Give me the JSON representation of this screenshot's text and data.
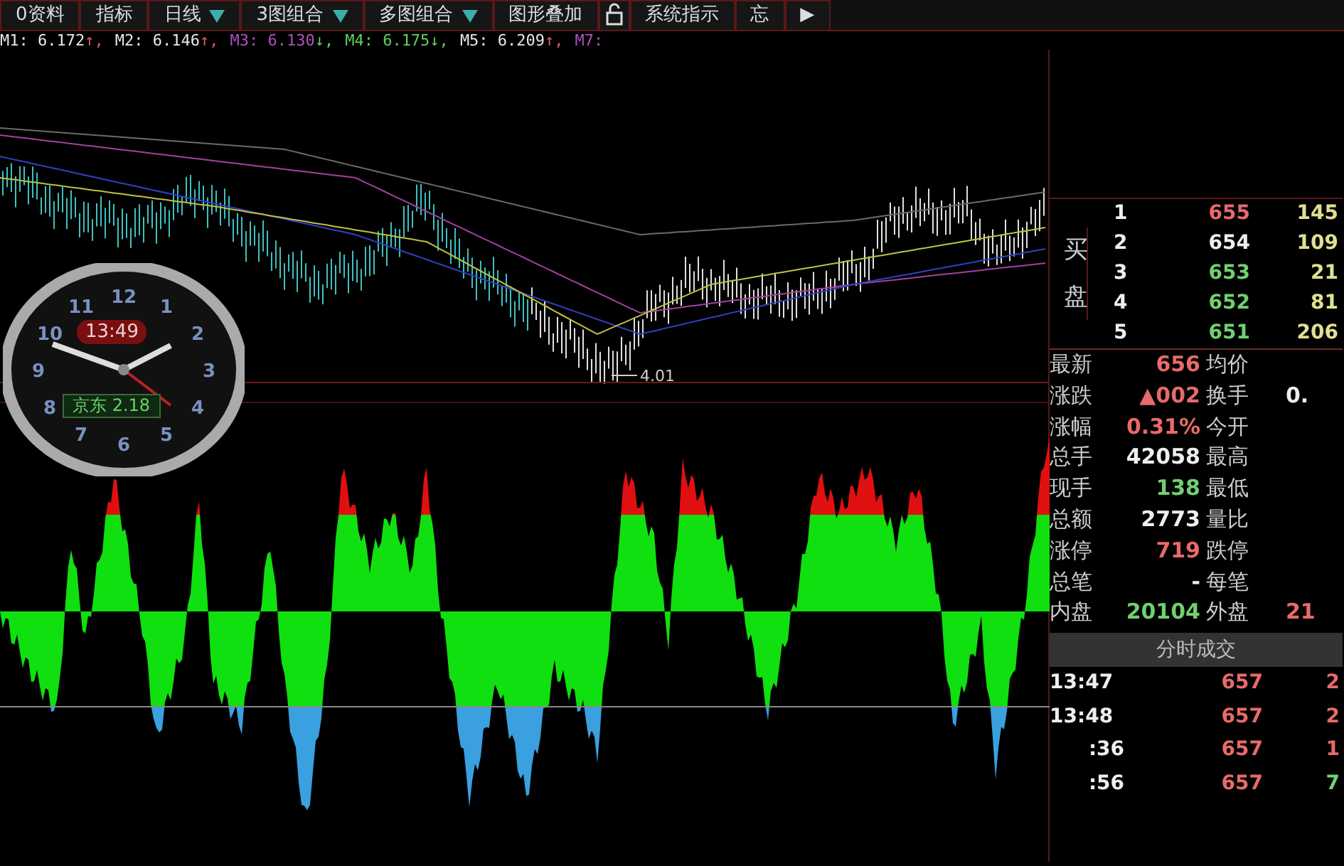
{
  "toolbar": [
    {
      "kind": "button",
      "label": "0资料"
    },
    {
      "kind": "button",
      "label": "指标"
    },
    {
      "kind": "dropdown",
      "label": "日线"
    },
    {
      "kind": "dropdown",
      "label": "3图组合"
    },
    {
      "kind": "dropdown",
      "label": "多图组合"
    },
    {
      "kind": "button",
      "label": "图形叠加"
    },
    {
      "kind": "lock"
    },
    {
      "kind": "button",
      "label": "系统指示"
    },
    {
      "kind": "button",
      "label": "忘"
    },
    {
      "kind": "button",
      "label": "▶"
    }
  ],
  "ma_line": [
    {
      "label": "M1:",
      "value": "6.172",
      "color": "#e8e8e8",
      "arrow": {
        "text": "↑,",
        "color": "#e06060"
      }
    },
    {
      "label": "M2:",
      "value": "6.146",
      "color": "#e8e8e8",
      "arrow": {
        "text": "↑,",
        "color": "#e06060"
      }
    },
    {
      "label": "M3:",
      "value": "6.130",
      "color": "#b050c0",
      "arrow": {
        "text": "↓,",
        "color": "#60d060"
      }
    },
    {
      "label": "M4:",
      "value": "6.175",
      "color": "#60d060",
      "arrow": {
        "text": "↓,",
        "color": "#60d060"
      }
    },
    {
      "label": "M5:",
      "value": "6.209",
      "color": "#e8e8e8",
      "arrow": {
        "text": "↑,",
        "color": "#e06060"
      }
    },
    {
      "label": "M7:",
      "color": "#b050c0"
    }
  ],
  "price_chart": {
    "low_label": "4.01"
  },
  "clock": {
    "numbers": [
      "12",
      "1",
      "2",
      "3",
      "4",
      "5",
      "6",
      "7",
      "8",
      "9",
      "10",
      "11"
    ],
    "time": "13:49",
    "ticker": "京东 2.18"
  },
  "order_book": {
    "side_label": "买盘",
    "levels": [
      {
        "level": "1",
        "price": "655",
        "volume": "145",
        "color": "#e86a6a"
      },
      {
        "level": "2",
        "price": "654",
        "volume": "109",
        "color": "#eeeeee"
      },
      {
        "level": "3",
        "price": "653",
        "volume": "21",
        "color": "#70d070"
      },
      {
        "level": "4",
        "price": "652",
        "volume": "81",
        "color": "#70d070"
      },
      {
        "level": "5",
        "price": "651",
        "volume": "206",
        "color": "#70d070"
      }
    ]
  },
  "stats": [
    {
      "left": {
        "label": "最新",
        "value": "656",
        "color": "#e86a6a"
      },
      "right": {
        "label": "均价"
      }
    },
    {
      "left": {
        "label": "涨跌",
        "value": "▲002",
        "color": "#e86a6a"
      },
      "right": {
        "label": "换手",
        "value": "0.",
        "color": "#eeeeee"
      }
    },
    {
      "left": {
        "label": "涨幅",
        "value": "0.31%",
        "color": "#e86a6a"
      },
      "right": {
        "label": "今开"
      }
    },
    {
      "left": {
        "label": "总手",
        "value": "42058",
        "color": "#eeeeee"
      },
      "right": {
        "label": "最高"
      }
    },
    {
      "left": {
        "label": "现手",
        "value": "138",
        "color": "#70d070"
      },
      "right": {
        "label": "最低"
      }
    },
    {
      "left": {
        "label": "总额",
        "value": "2773",
        "color": "#eeeeee"
      },
      "right": {
        "label": "量比"
      }
    },
    {
      "left": {
        "label": "涨停",
        "value": "719",
        "color": "#e86a6a"
      },
      "right": {
        "label": "跌停"
      }
    },
    {
      "left": {
        "label": "总笔",
        "value": "-",
        "color": "#eeeeee"
      },
      "right": {
        "label": "每笔"
      }
    },
    {
      "left": {
        "label": "内盘",
        "value": "20104",
        "color": "#70d070"
      },
      "right": {
        "label": "外盘",
        "value": "21",
        "color": "#e86a6a"
      }
    }
  ],
  "trades": {
    "title": "分时成交",
    "rows": [
      {
        "time": "13:47",
        "price": "657",
        "volume": "2",
        "color": "#e86a6a"
      },
      {
        "time": "13:48",
        "price": "657",
        "volume": "2",
        "color": "#e86a6a"
      },
      {
        "time": ":36",
        "price": "657",
        "volume": "1",
        "color": "#e86a6a"
      },
      {
        "time": ":56",
        "price": "657",
        "volume": "7",
        "color": "#70d070"
      }
    ]
  }
}
